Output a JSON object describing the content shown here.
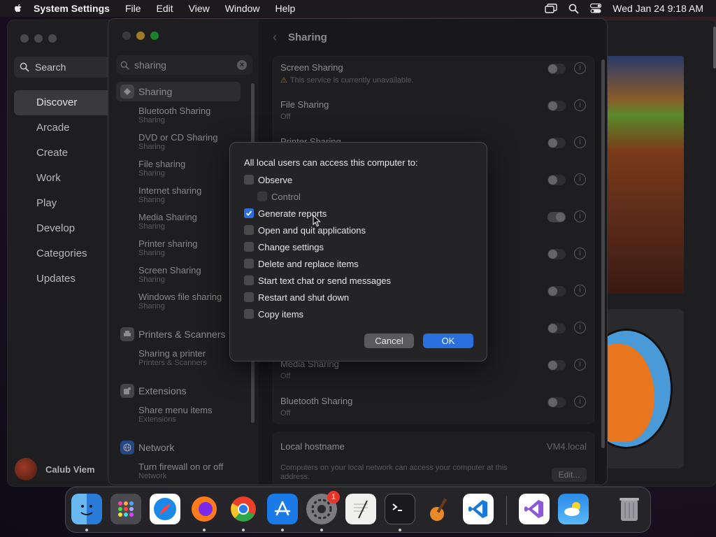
{
  "menubar": {
    "app_name": "System Settings",
    "menus": [
      "File",
      "Edit",
      "View",
      "Window",
      "Help"
    ],
    "datetime": "Wed Jan 24  9:18 AM"
  },
  "app_store": {
    "search_label": "Search",
    "nav": [
      "Discover",
      "Arcade",
      "Create",
      "Work",
      "Play",
      "Develop",
      "Categories",
      "Updates"
    ],
    "selected": "Discover",
    "user_name": "Calub Viem"
  },
  "settings": {
    "search_value": "sharing",
    "sidebar": {
      "sharing_label": "Sharing",
      "sharing_results": [
        {
          "title": "Bluetooth Sharing",
          "sub": "Sharing"
        },
        {
          "title": "DVD or CD Sharing",
          "sub": "Sharing"
        },
        {
          "title": "File sharing",
          "sub": "Sharing"
        },
        {
          "title": "Internet sharing",
          "sub": "Sharing"
        },
        {
          "title": "Media Sharing",
          "sub": "Sharing"
        },
        {
          "title": "Printer sharing",
          "sub": "Sharing"
        },
        {
          "title": "Screen Sharing",
          "sub": "Sharing"
        },
        {
          "title": "Windows file sharing",
          "sub": "Sharing"
        }
      ],
      "printers_label": "Printers & Scanners",
      "printers_results": [
        {
          "title": "Sharing a printer",
          "sub": "Printers & Scanners"
        }
      ],
      "extensions_label": "Extensions",
      "extensions_results": [
        {
          "title": "Share menu items",
          "sub": "Extensions"
        }
      ],
      "network_label": "Network",
      "network_results": [
        {
          "title": "Turn firewall on or off",
          "sub": "Network"
        }
      ]
    },
    "main": {
      "title": "Sharing",
      "rows": [
        {
          "title": "Screen Sharing",
          "sub": "This service is currently unavailable.",
          "warning": true,
          "on": false
        },
        {
          "title": "File Sharing",
          "sub": "Off",
          "on": false
        },
        {
          "title": "Printer Sharing",
          "sub": "",
          "on": false
        },
        {
          "title": "",
          "sub": "",
          "on": false
        },
        {
          "title": "",
          "sub": "",
          "on": true
        },
        {
          "title": "",
          "sub": "",
          "on": false
        },
        {
          "title": "",
          "sub": "",
          "on": false
        },
        {
          "title": "",
          "sub": "",
          "on": false
        },
        {
          "title": "Media Sharing",
          "sub": "Off",
          "on": false
        },
        {
          "title": "Bluetooth Sharing",
          "sub": "Off",
          "on": false
        }
      ],
      "hostname_label": "Local hostname",
      "hostname_value": "VM4.local",
      "hostname_desc": "Computers on your local network can access your computer at this address.",
      "edit_label": "Edit..."
    }
  },
  "dialog": {
    "title": "All local users can access this computer to:",
    "options": [
      {
        "label": "Observe",
        "checked": false,
        "disabled": false,
        "indent": false
      },
      {
        "label": "Control",
        "checked": false,
        "disabled": true,
        "indent": true
      },
      {
        "label": "Generate reports",
        "checked": true,
        "disabled": false,
        "indent": false
      },
      {
        "label": "Open and quit applications",
        "checked": false,
        "disabled": false,
        "indent": false
      },
      {
        "label": "Change settings",
        "checked": false,
        "disabled": false,
        "indent": false
      },
      {
        "label": "Delete and replace items",
        "checked": false,
        "disabled": false,
        "indent": false
      },
      {
        "label": "Start text chat or send messages",
        "checked": false,
        "disabled": false,
        "indent": false
      },
      {
        "label": "Restart and shut down",
        "checked": false,
        "disabled": false,
        "indent": false
      },
      {
        "label": "Copy items",
        "checked": false,
        "disabled": false,
        "indent": false
      }
    ],
    "cancel_label": "Cancel",
    "ok_label": "OK"
  },
  "dock": {
    "apps": [
      "finder-icon",
      "launchpad-icon",
      "safari-icon",
      "firefox-icon",
      "chrome-icon",
      "app-store-icon",
      "system-settings-icon",
      "textedit-icon",
      "terminal-icon",
      "garageband-icon",
      "vscode-icon",
      "visual-studio-icon",
      "weather-icon",
      "trash-icon"
    ],
    "badge": "1"
  },
  "colors": {
    "accent": "#2a6fdb",
    "warning": "#e8b42a",
    "badge": "#e8352a"
  }
}
